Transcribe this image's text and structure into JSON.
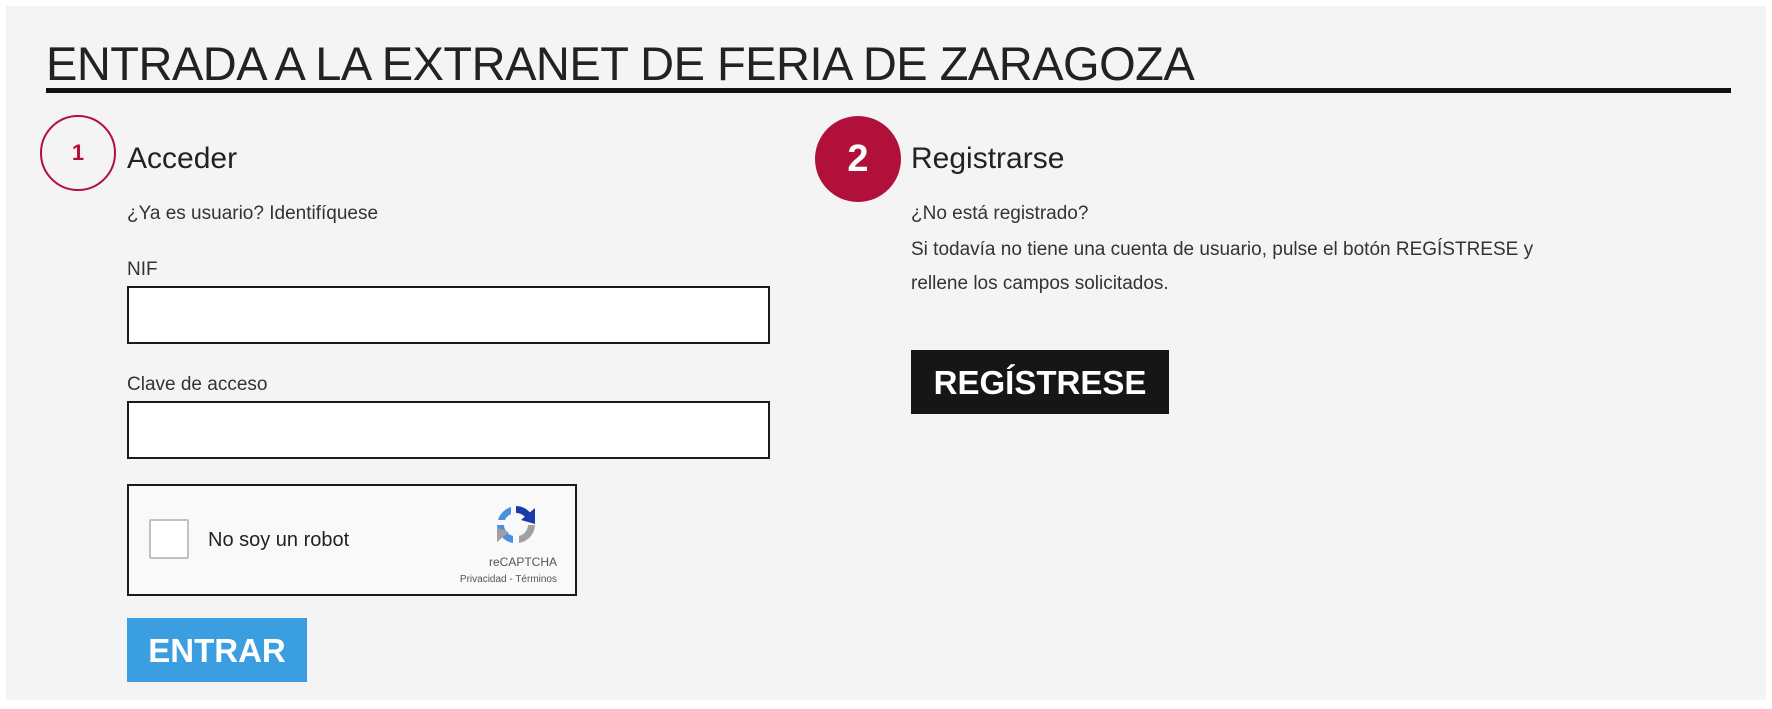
{
  "page": {
    "title": "ENTRADA A LA EXTRANET DE FERIA DE ZARAGOZA"
  },
  "login": {
    "step_number": "1",
    "heading": "Acceder",
    "subtitle": "¿Ya es usuario? Identifíquese",
    "nif_label": "NIF",
    "nif_value": "",
    "password_label": "Clave de acceso",
    "password_value": "",
    "recaptcha": {
      "label": "No soy un robot",
      "brand": "reCAPTCHA",
      "links": "Privacidad - Términos",
      "checked": false
    },
    "submit_label": "ENTRAR"
  },
  "register": {
    "step_number": "2",
    "heading": "Registrarse",
    "question": "¿No está registrado?",
    "description_line1": "Si todavía no tiene una cuenta de usuario, pulse el botón REGÍSTRESE y",
    "description_line2": "rellene los campos solicitados.",
    "button_label": "REGÍSTRESE"
  },
  "colors": {
    "accent": "#b0103a",
    "entrar_button": "#3a9ee0",
    "register_button": "#161616",
    "panel_background": "#f4f4f4"
  },
  "icons": {
    "recaptcha_logo": "recaptcha-icon"
  }
}
